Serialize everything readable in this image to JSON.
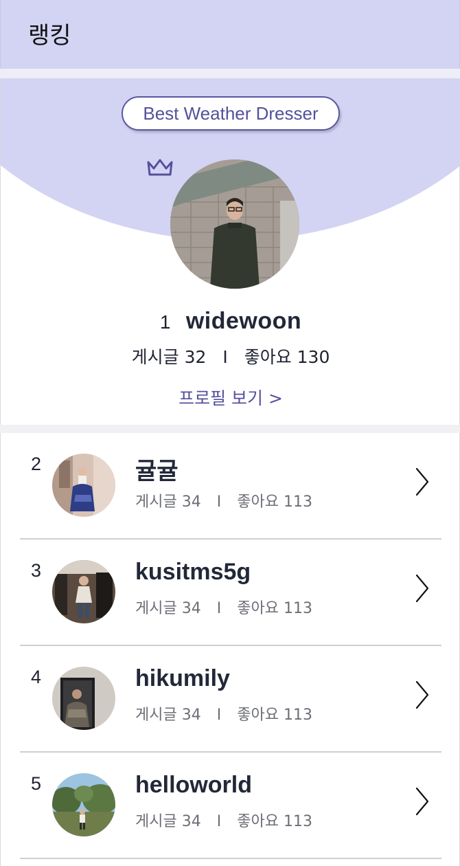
{
  "header": {
    "title": "랭킹"
  },
  "top_ranker": {
    "award_label": "Best Weather Dresser",
    "rank": "1",
    "username": "widewoon",
    "posts_label": "게시글",
    "posts_count": "32",
    "separator": "I",
    "likes_label": "좋아요",
    "likes_count": "130",
    "profile_link": "프로필 보기 >"
  },
  "ranking_list": [
    {
      "rank": "2",
      "username": "귤귤",
      "posts_label": "게시글",
      "posts_count": "34",
      "separator": "I",
      "likes_label": "좋아요",
      "likes_count": "113"
    },
    {
      "rank": "3",
      "username": "kusitms5g",
      "posts_label": "게시글",
      "posts_count": "34",
      "separator": "I",
      "likes_label": "좋아요",
      "likes_count": "113"
    },
    {
      "rank": "4",
      "username": "hikumily",
      "posts_label": "게시글",
      "posts_count": "34",
      "separator": "I",
      "likes_label": "좋아요",
      "likes_count": "113"
    },
    {
      "rank": "5",
      "username": "helloworld",
      "posts_label": "게시글",
      "posts_count": "34",
      "separator": "I",
      "likes_label": "좋아요",
      "likes_count": "113"
    }
  ],
  "icons": {
    "crown": "crown-icon",
    "chevron": "chevron-right-icon"
  },
  "colors": {
    "accent": "#55509c",
    "header_bg": "#d3d3f3",
    "divider": "#cfcfd3"
  }
}
